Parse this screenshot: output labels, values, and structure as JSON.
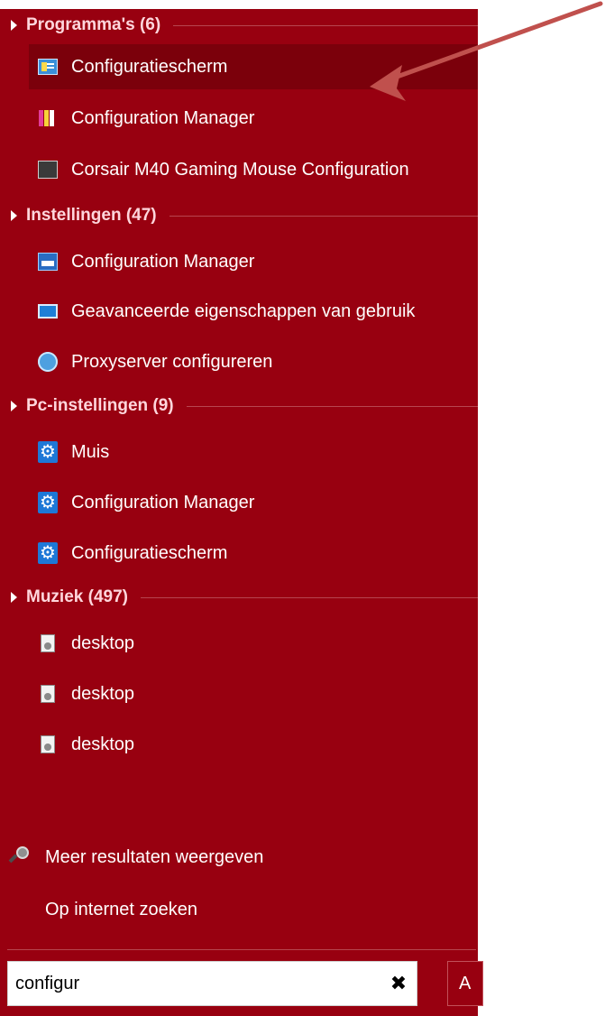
{
  "groups": [
    {
      "title": "Programma's (6)",
      "items": [
        {
          "label": "Configuratiescherm",
          "icon": "control-panel-icon"
        },
        {
          "label": "Configuration Manager",
          "icon": "configuration-manager-icon"
        },
        {
          "label": "Corsair M40 Gaming Mouse Configuration",
          "icon": "corsair-icon"
        }
      ]
    },
    {
      "title": "Instellingen (47)",
      "items": [
        {
          "label": "Configuration Manager",
          "icon": "settings-applet-icon"
        },
        {
          "label": "Geavanceerde eigenschappen van gebruik",
          "icon": "monitor-icon"
        },
        {
          "label": "Proxyserver configureren",
          "icon": "proxy-icon"
        }
      ]
    },
    {
      "title": "Pc-instellingen (9)",
      "items": [
        {
          "label": "Muis",
          "icon": "gear-icon"
        },
        {
          "label": "Configuration Manager",
          "icon": "gear-icon"
        },
        {
          "label": "Configuratiescherm",
          "icon": "gear-icon"
        }
      ]
    },
    {
      "title": "Muziek (497)",
      "items": [
        {
          "label": "desktop",
          "icon": "file-icon"
        },
        {
          "label": "desktop",
          "icon": "file-icon"
        },
        {
          "label": "desktop",
          "icon": "file-icon"
        }
      ]
    }
  ],
  "footer": {
    "more_results": "Meer resultaten weergeven",
    "internet_search": "Op internet zoeken"
  },
  "search": {
    "value": "configur",
    "clear_glyph": "✖"
  },
  "side_button_label": "A",
  "colors": {
    "panel_bg": "#980010",
    "highlight_bg": "#7b000b",
    "arrow": "#c0504d"
  }
}
